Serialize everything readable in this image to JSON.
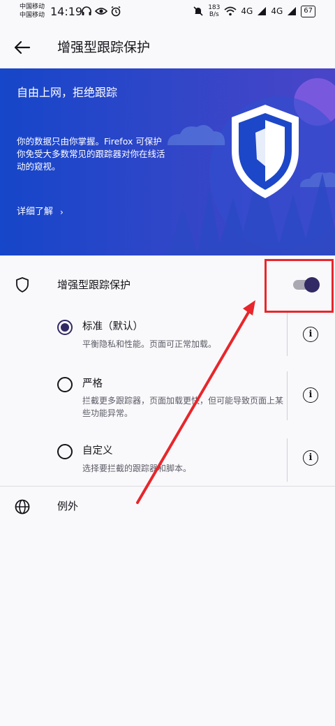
{
  "status_bar": {
    "carrier_1": "中国移动",
    "carrier_2": "中国移动",
    "time": "14:19",
    "net_speed_value": "183",
    "net_speed_unit": "B/s",
    "signal_1": "4G",
    "signal_2": "4G",
    "battery": "67"
  },
  "app_bar": {
    "title": "增强型跟踪保护"
  },
  "banner": {
    "title": "自由上网，拒绝跟踪",
    "description": "你的数据只由你掌握。Firefox 可保护你免受大多数常见的跟踪器对你在线活动的窥视。",
    "learn_more": "详细了解",
    "learn_more_chevron": "›",
    "background_color": "#1c47c8"
  },
  "settings": {
    "main_toggle": {
      "label": "增强型跟踪保护",
      "enabled": true
    },
    "options": [
      {
        "title": "标准（默认）",
        "description": "平衡隐私和性能。页面可正常加载。",
        "selected": true,
        "info": "i"
      },
      {
        "title": "严格",
        "description": "拦截更多跟踪器，页面加载更快，但可能导致页面上某些功能异常。",
        "selected": false,
        "info": "i"
      },
      {
        "title": "自定义",
        "description": "选择要拦截的跟踪器和脚本。",
        "selected": false,
        "info": "i"
      }
    ],
    "exceptions": {
      "label": "例外"
    }
  },
  "colors": {
    "accent": "#312a64",
    "annotation": "#e8262b"
  }
}
